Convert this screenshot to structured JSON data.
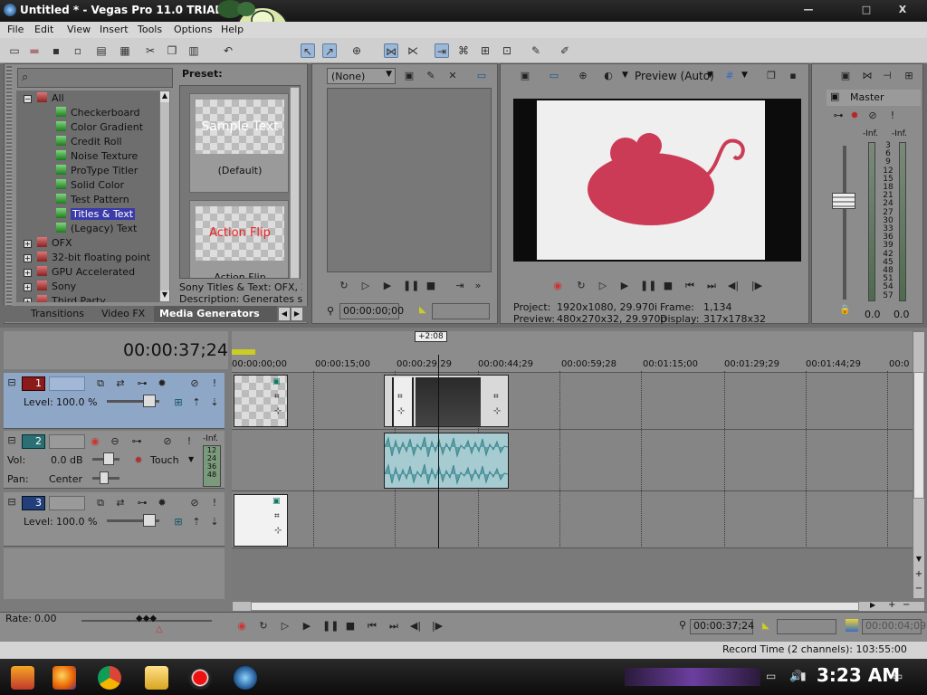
{
  "window": {
    "title": "Untitled * - Vegas Pro 11.0 TRIAL",
    "min": "—",
    "max": "□",
    "close": "X"
  },
  "menu": [
    "File",
    "Edit",
    "View",
    "Insert",
    "Tools",
    "Options",
    "Help"
  ],
  "explorer": {
    "search_placeholder": "",
    "preset_label": "Preset:",
    "tree": {
      "root": "All",
      "children": [
        "Checkerboard",
        "Color Gradient",
        "Credit Roll",
        "Noise Texture",
        "ProType Titler",
        "Solid Color",
        "Test Pattern",
        "Titles & Text",
        "(Legacy) Text"
      ],
      "selected": "Titles & Text",
      "groups": [
        "OFX",
        "32-bit floating point",
        "GPU Accelerated",
        "Sony",
        "Third Party"
      ]
    },
    "presets": [
      {
        "thumb_text": "Sample Text",
        "caption": "(Default)"
      },
      {
        "thumb_text": "Action Flip",
        "caption": "Action Flip"
      }
    ],
    "info_line1": "Sony Titles & Text: OFX, 32",
    "info_line2": "Description: Generates stati",
    "tabs": [
      "Transitions",
      "Video FX",
      "Media Generators"
    ],
    "active_tab": "Media Generators"
  },
  "trimmer": {
    "dropdown": "(None)",
    "timecode": "00:00:00;00"
  },
  "preview": {
    "quality": "Preview (Auto)",
    "project_label": "Project:",
    "project_value": "1920x1080, 29.970i",
    "preview_label": "Preview:",
    "preview_value": "480x270x32, 29.970p",
    "frame_label": "Frame:",
    "frame_value": "1,134",
    "display_label": "Display:",
    "display_value": "317x178x32"
  },
  "master": {
    "label": "Master",
    "left_peak": "-Inf.",
    "right_peak": "-Inf.",
    "scale": [
      "3",
      "6",
      "9",
      "12",
      "15",
      "18",
      "21",
      "24",
      "27",
      "30",
      "33",
      "36",
      "39",
      "42",
      "45",
      "48",
      "51",
      "54",
      "57"
    ],
    "left_level": "0.0",
    "right_level": "0.0"
  },
  "timeline": {
    "cursor_time": "00:00:37;24",
    "ruler": [
      "00:00:00;00",
      "00:00:15;00",
      "00:00:29;29",
      "00:00:44;29",
      "00:00:59;28",
      "00:01:15;00",
      "00:01:29;29",
      "00:01:44;29",
      "00:0"
    ],
    "edit_tooltip": "+2:08",
    "tracks": [
      {
        "num": "1",
        "type": "video",
        "level_label": "Level:",
        "level_value": "100.0 %"
      },
      {
        "num": "2",
        "type": "audio",
        "vol_label": "Vol:",
        "vol_value": "0.0 dB",
        "pan_label": "Pan:",
        "pan_value": "Center",
        "mode": "Touch",
        "meter_top": "-Inf.",
        "meter_scale": [
          "12",
          "24",
          "36",
          "48"
        ]
      },
      {
        "num": "3",
        "type": "video",
        "level_label": "Level:",
        "level_value": "100.0 %"
      }
    ]
  },
  "transport": {
    "rate_label": "Rate:",
    "rate_value": "0.00",
    "timecode": "00:00:37;24",
    "end_timecode": "00:00:04;09",
    "record_time": "Record Time (2 channels): 103:55:00"
  },
  "taskbar": {
    "clock": "3:23 AM"
  }
}
